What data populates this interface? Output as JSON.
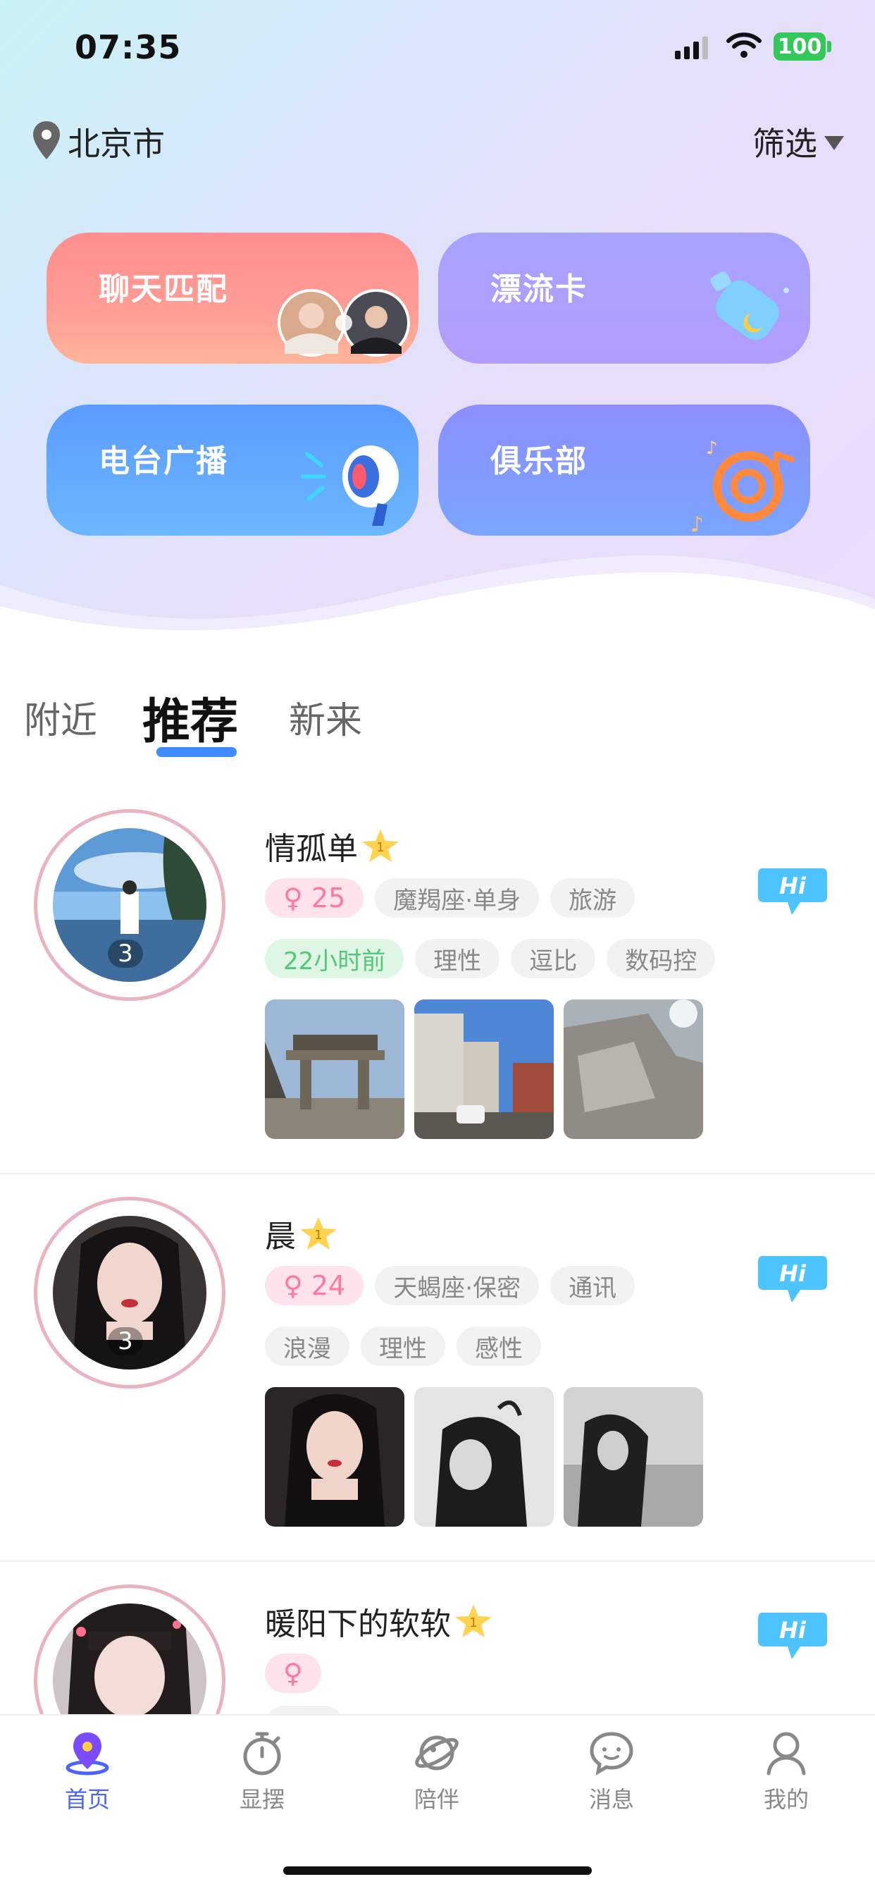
{
  "status_bar": {
    "time": "07:35",
    "battery": "100"
  },
  "header": {
    "city": "北京市",
    "filter_label": "筛选"
  },
  "features": [
    {
      "label": "聊天匹配"
    },
    {
      "label": "漂流卡"
    },
    {
      "label": "电台广播"
    },
    {
      "label": "俱乐部"
    }
  ],
  "tabs": {
    "nearby": "附近",
    "recommended": "推荐",
    "new": "新来"
  },
  "users": [
    {
      "name": "情孤单",
      "rank": "1",
      "photo_count": "3",
      "gender_age": "♀ 25",
      "row1": [
        "魔羯座·单身",
        "旅游"
      ],
      "active": "22小时前",
      "row2": [
        "理性",
        "逗比",
        "数码控"
      ]
    },
    {
      "name": "晨",
      "rank": "1",
      "photo_count": "3",
      "gender_age": "♀ 24",
      "row1": [
        "天蝎座·保密",
        "通讯"
      ],
      "row2": [
        "浪漫",
        "理性",
        "感性"
      ]
    },
    {
      "name": "暖阳下的软软",
      "rank": "1",
      "gender_age": "♀"
    }
  ],
  "hi_label": "Hi",
  "nav": [
    {
      "label": "首页",
      "icon": "planet-pin-icon"
    },
    {
      "label": "显摆",
      "icon": "stopwatch-icon"
    },
    {
      "label": "陪伴",
      "icon": "planet-icon"
    },
    {
      "label": "消息",
      "icon": "chat-bubble-icon"
    },
    {
      "label": "我的",
      "icon": "person-icon"
    }
  ],
  "colors": {
    "accent": "#3d8bff",
    "nav_active": "#4b63ff",
    "gender": "#ff77a5",
    "online": "#52c878"
  }
}
